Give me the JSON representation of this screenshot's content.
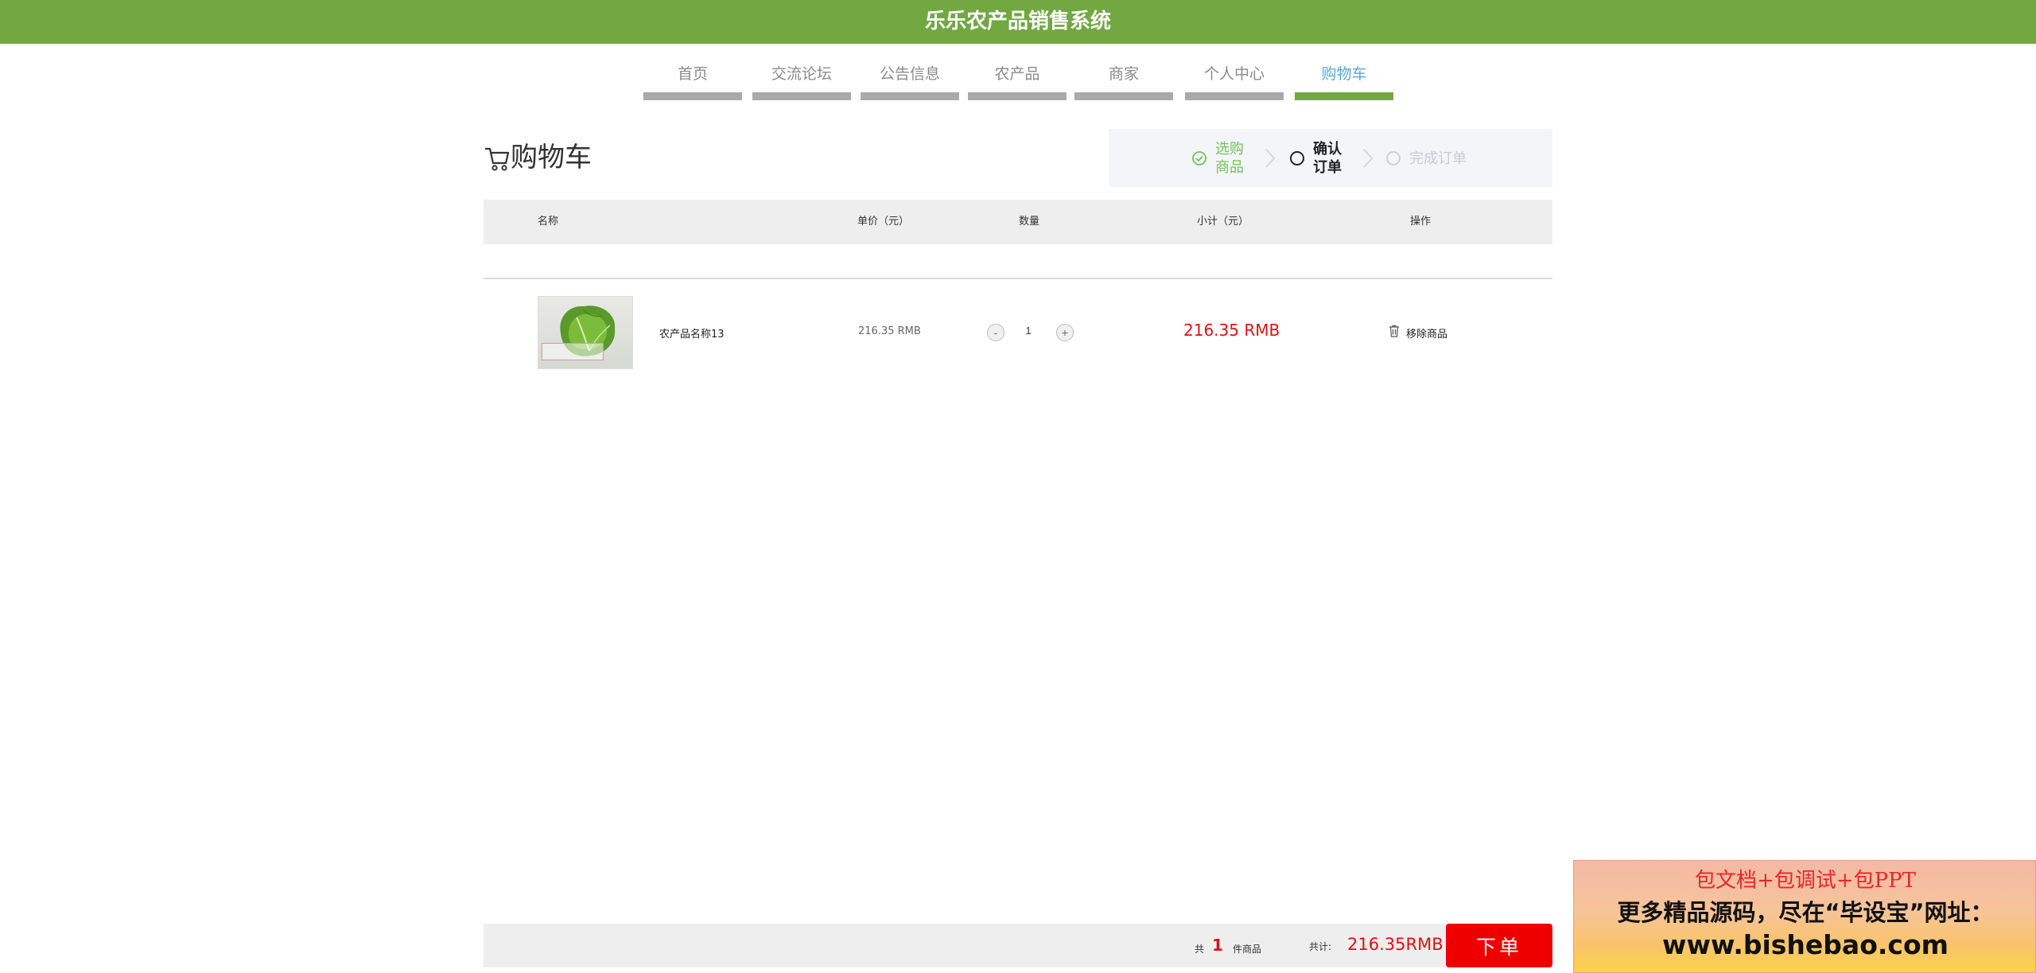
{
  "header": {
    "title": "乐乐农产品销售系统"
  },
  "nav": [
    {
      "label": "首页",
      "active": false
    },
    {
      "label": "交流论坛",
      "active": false
    },
    {
      "label": "公告信息",
      "active": false
    },
    {
      "label": "农产品",
      "active": false
    },
    {
      "label": "商家",
      "active": false
    },
    {
      "label": "个人中心",
      "active": false
    },
    {
      "label": "购物车",
      "active": true
    }
  ],
  "cart": {
    "title": "购物车",
    "icon": "cart-icon"
  },
  "steps": [
    {
      "label": "选购商品",
      "state": "done",
      "icon": "check-circle-icon"
    },
    {
      "label": "确认订单",
      "state": "current",
      "icon": "circle-icon"
    },
    {
      "label": "完成订单",
      "state": "pending",
      "icon": "circle-icon"
    }
  ],
  "table": {
    "headers": {
      "name": "名称",
      "unit_price": "单价（元）",
      "quantity": "数量",
      "subtotal": "小计（元）",
      "action": "操作"
    },
    "rows": [
      {
        "name": "农产品名称13",
        "unit_price": "216.35 RMB",
        "quantity": "1",
        "minus": "-",
        "plus": "+",
        "subtotal": "216.35 RMB",
        "remove_label": "移除商品"
      }
    ]
  },
  "summary": {
    "count_prefix": "共",
    "count": "1",
    "count_suffix": "件商品",
    "total_label": "共计:",
    "total": "216.35RMB",
    "order_button": "下单"
  },
  "promo": {
    "line1": "包文档+包调试+包PPT",
    "line2": "更多精品源码，尽在“毕设宝”网址：",
    "line3": "www.bishebao.com"
  },
  "colors": {
    "brand_green": "#72a742",
    "price_red": "#dd1111",
    "order_red": "#ee0000",
    "nav_active_text": "#5aa8d6"
  }
}
